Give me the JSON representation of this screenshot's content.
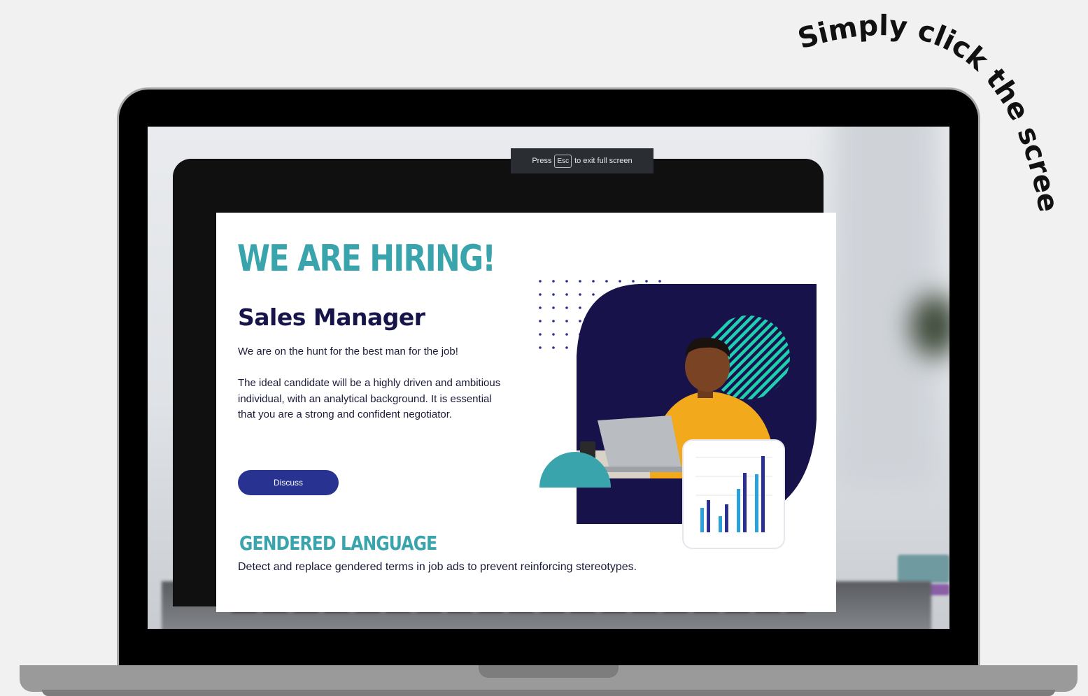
{
  "hint_text": "Simply click the screen...",
  "fullscreen_banner": {
    "press": "Press",
    "key": "Esc",
    "suffix": "to exit full screen"
  },
  "slide": {
    "title": "WE ARE HIRING!",
    "job_title": "Sales Manager",
    "intro": "We are on the hunt for the best man for the job!",
    "description": "The ideal candidate will be a highly driven and ambitious individual, with an analytical background. It is essential that you are a strong and confident negotiator.",
    "button_label": "Discuss",
    "section_title": "GENDERED LANGUAGE",
    "section_description": "Detect and replace gendered terms in job ads to prevent reinforcing stereotypes."
  },
  "colors": {
    "teal_heading": "#3aa4ad",
    "navy": "#17144a",
    "button_blue": "#283291",
    "mint_stripes": "#1fd0b0"
  }
}
